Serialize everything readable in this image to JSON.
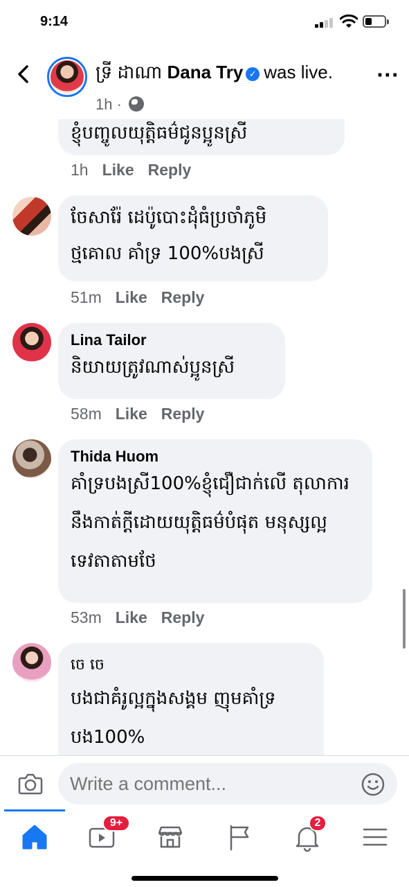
{
  "status": {
    "time": "9:14"
  },
  "header": {
    "page_name_khmer": "ទ្រី ដាណា",
    "page_name": "Dana Try",
    "action": "was live.",
    "time": "1h ·",
    "verified_icon": "verified-badge-icon"
  },
  "comments": [
    {
      "name": "",
      "text": "ខ្ញុំបញ្ចូលយុត្តិធម៌ជូនប្អូនស្រី",
      "time": "1h",
      "like": "Like",
      "reply": "Reply"
    },
    {
      "name": "",
      "text": "ចែសារ៉ែ ដេប៉ូបោះដុំធំប្រចាំភូមិថ្មគោល គាំទ្រ 100%បងស្រី",
      "time": "51m",
      "like": "Like",
      "reply": "Reply"
    },
    {
      "name": "Lina Tailor",
      "text": "និយាយត្រូវណាស់ប្អូនស្រី",
      "time": "58m",
      "like": "Like",
      "reply": "Reply"
    },
    {
      "name": "Thida Huom",
      "text": "គាំទ្របងស្រី100%ខ្ញុំជឿជាក់លើ តុលាការនឹងកាត់ក្តីដោយយុត្តិធម៌បំផុត មនុស្សល្អទេវតាតាមថែ",
      "time": "53m",
      "like": "Like",
      "reply": "Reply"
    },
    {
      "name": "",
      "text": "ចេ ចេ",
      "text2": "បងជាគំរូល្អក្នុងសង្គម ញុមគាំទ្រ បង100%",
      "time": "",
      "like": "",
      "reply": ""
    }
  ],
  "composer": {
    "placeholder": "Write a comment..."
  },
  "tabbar": {
    "active": "home",
    "tabs": [
      {
        "icon": "home-icon"
      },
      {
        "icon": "video-icon",
        "badge": "9+"
      },
      {
        "icon": "marketplace-icon"
      },
      {
        "icon": "flag-icon"
      },
      {
        "icon": "bell-icon",
        "badge": "2"
      },
      {
        "icon": "menu-icon"
      }
    ]
  },
  "colors": {
    "accent": "#1877f2",
    "bubble": "#f0f2f5",
    "badge": "#e41e3f",
    "meta": "#65676b"
  }
}
